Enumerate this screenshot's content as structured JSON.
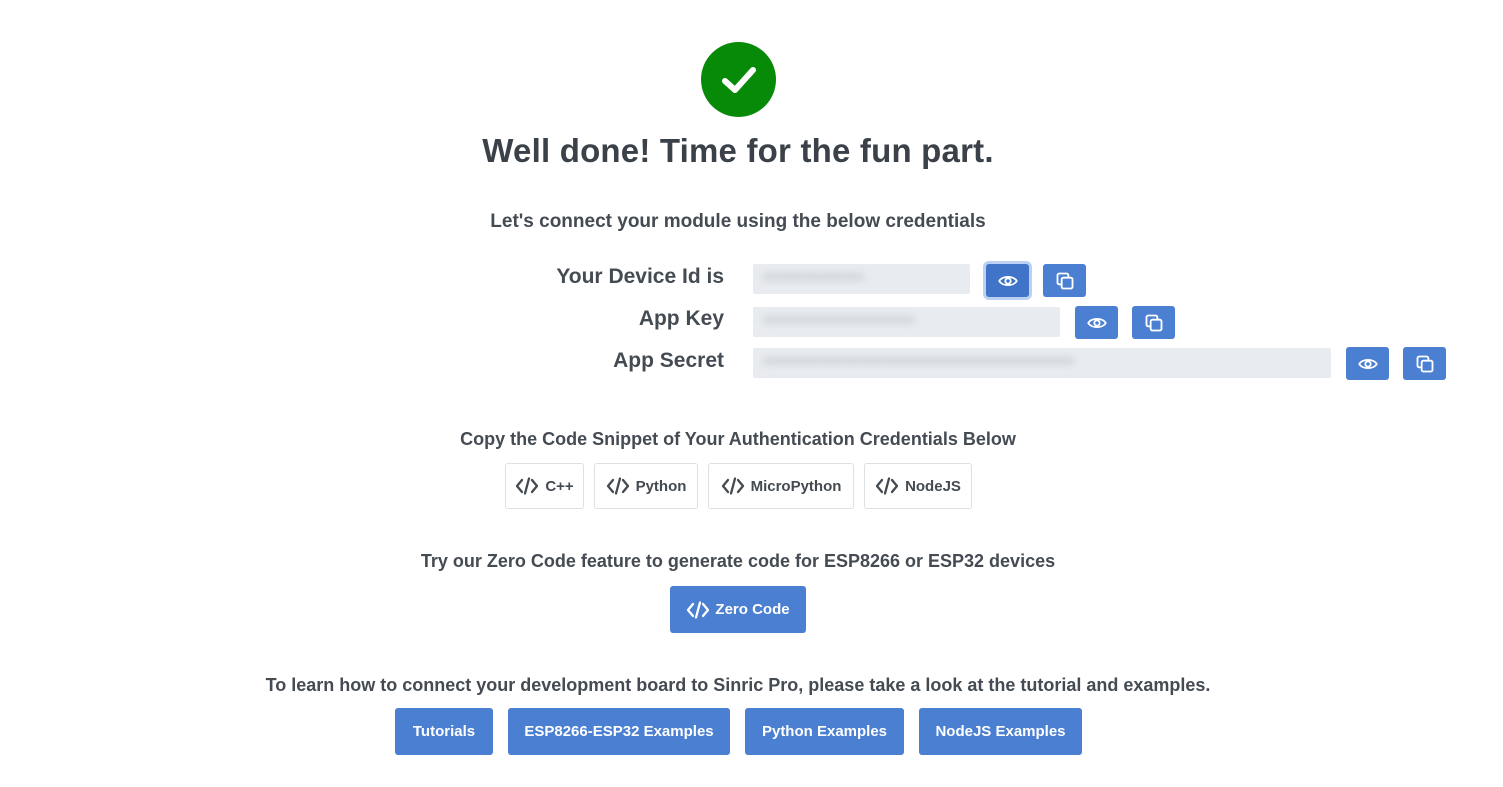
{
  "header": {
    "title": "Well done! Time for the fun part.",
    "subtitle": "Let's connect your module using the below credentials"
  },
  "credentials": {
    "device_id": {
      "label": "Your Device Id is",
      "value": "••••••••••••••••••••••••"
    },
    "app_key": {
      "label": "App Key",
      "value": "••••••••••••••••••••••••••••••••••••"
    },
    "app_secret": {
      "label": "App Secret",
      "value": "••••••••••••••••••••••••••••••••••••••••••••••••••••••••••••••••••••••••••"
    }
  },
  "snippets": {
    "heading": "Copy the Code Snippet of Your Authentication Credentials Below",
    "languages": [
      "C++",
      "Python",
      "MicroPython",
      "NodeJS"
    ]
  },
  "zero_code": {
    "heading": "Try our Zero Code feature to generate code for ESP8266 or ESP32 devices",
    "button": "Zero Code"
  },
  "resources": {
    "heading": "To learn how to connect your development board to Sinric Pro, please take a look at the tutorial and examples.",
    "buttons": [
      "Tutorials",
      "ESP8266-ESP32 Examples",
      "Python Examples",
      "NodeJS Examples"
    ]
  },
  "colors": {
    "success": "#078a07",
    "accent": "#4a7fd2",
    "text": "#3f454d"
  },
  "icons": {
    "success": "check-icon",
    "reveal": "eye-icon",
    "copy": "copy-icon",
    "code": "code-icon"
  }
}
